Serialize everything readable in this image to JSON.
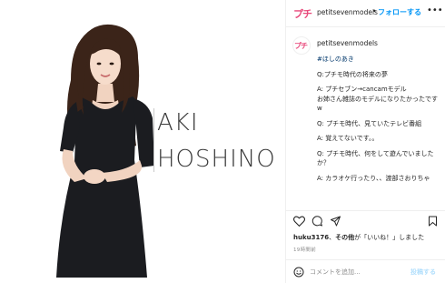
{
  "brand": {
    "logo_text": "プチ",
    "accent_color": "#e8497b",
    "link_color": "#0095f6"
  },
  "photo": {
    "name_first": "AKI",
    "name_last": "HOSHINO"
  },
  "header": {
    "username": "petitsevenmodels",
    "separator": "•",
    "follow_label": "フォローする",
    "more_label": "•••"
  },
  "caption": {
    "username": "petitsevenmodels",
    "lines": [
      "#ほしのあき",
      "Q:プチモ時代の将来の夢",
      "A: プチセブン→cancamモデル\nお姉さん雑誌のモデルになりたかったです w",
      "Q: プチモ時代、見ていたテレビ番組",
      "A: 覚えてないです。。",
      "Q: プチモ時代、何をして遊んでいましたか？",
      "A: カラオケ行ったり、、渡部さおりちゃ"
    ]
  },
  "actions": {
    "icons": [
      "heart-icon",
      "comment-icon",
      "share-icon",
      "bookmark-icon"
    ]
  },
  "likes": {
    "user": "huku3176",
    "suffix_bold": "その他",
    "suffix": "が「いいね！」しました"
  },
  "timestamp": "19時間前",
  "comment": {
    "placeholder": "コメントを追加...",
    "post_label": "投稿する"
  }
}
